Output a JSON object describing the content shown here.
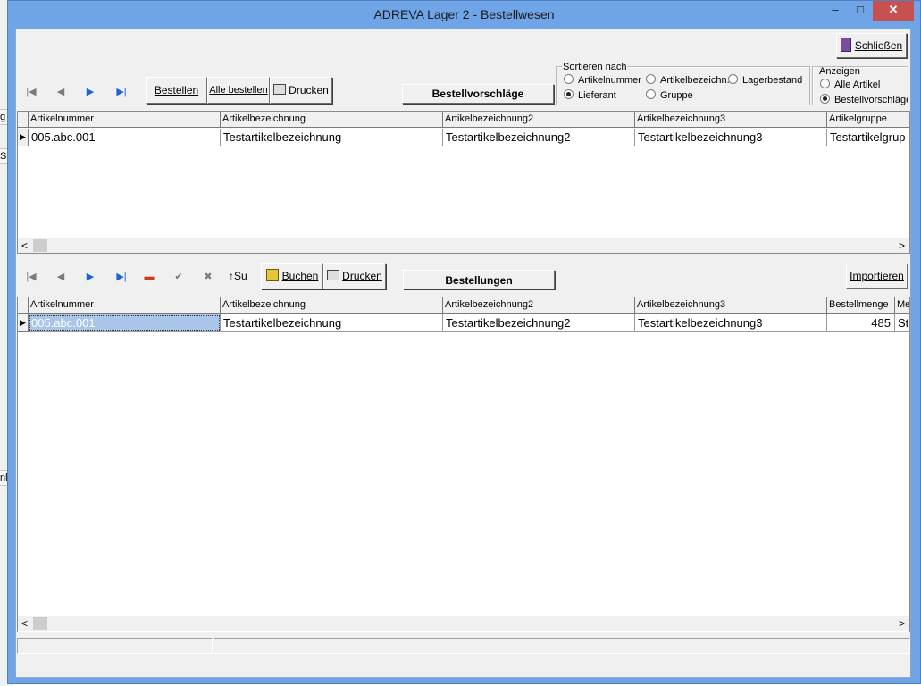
{
  "window": {
    "title": "ADREVA Lager 2 - Bestellwesen",
    "minimize": "–",
    "maximize": "□",
    "close": "✕"
  },
  "bg_rows": [
    "g",
    "S",
    "nl"
  ],
  "top": {
    "close_button": "Schließen",
    "toolbar": {
      "bestellen": "Bestellen",
      "alle_bestellen": "Alle bestellen",
      "drucken": "Drucken"
    },
    "nav": {
      "first": "|◀",
      "prev": "◀",
      "next": "▶",
      "last": "▶|"
    },
    "section_title": "Bestellvorschläge",
    "sort": {
      "legend": "Sortieren nach",
      "options": [
        "Artikelnummer",
        "Artikelbezeichn.",
        "Lagerbestand",
        "Lieferant",
        "Gruppe"
      ],
      "selected": "Lieferant"
    },
    "show": {
      "legend": "Anzeigen",
      "options": [
        "Alle Artikel",
        "Bestellvorschläge"
      ],
      "selected": "Bestellvorschläge"
    },
    "columns": [
      "Artikelnummer",
      "Artikelbezeichnung",
      "Artikelbezeichnung2",
      "Artikelbezeichnung3",
      "Artikelgruppe"
    ],
    "rows": [
      [
        "005.abc.001",
        "Testartikelbezeichnung",
        "Testartikelbezeichnung2",
        "Testartikelbezeichnung3",
        "Testartikelgrup"
      ]
    ]
  },
  "bottom": {
    "nav": {
      "first": "|◀",
      "prev": "◀",
      "next": "▶",
      "last": "▶|",
      "delete": "▬",
      "post": "✔",
      "cancel": "✖",
      "sort_up": "Su"
    },
    "toolbar": {
      "buchen": "Buchen",
      "drucken": "Drucken",
      "importieren": "Importieren"
    },
    "section_title": "Bestellungen",
    "columns": [
      "Artikelnummer",
      "Artikelbezeichnung",
      "Artikelbezeichnung2",
      "Artikelbezeichnung3",
      "Bestellmenge",
      "Me"
    ],
    "rows": [
      [
        "005.abc.001",
        "Testartikelbezeichnung",
        "Testartikelbezeichnung2",
        "Testartikelbezeichnung3",
        "485",
        "Stü"
      ]
    ]
  },
  "scroll": {
    "left": "<",
    "right": ">"
  },
  "colors": {
    "title_bar": "#6fa4e6",
    "close": "#c75050",
    "face": "#f0f0f0",
    "selection": "#a9c6e8",
    "nav_blue": "#1a63d0"
  }
}
